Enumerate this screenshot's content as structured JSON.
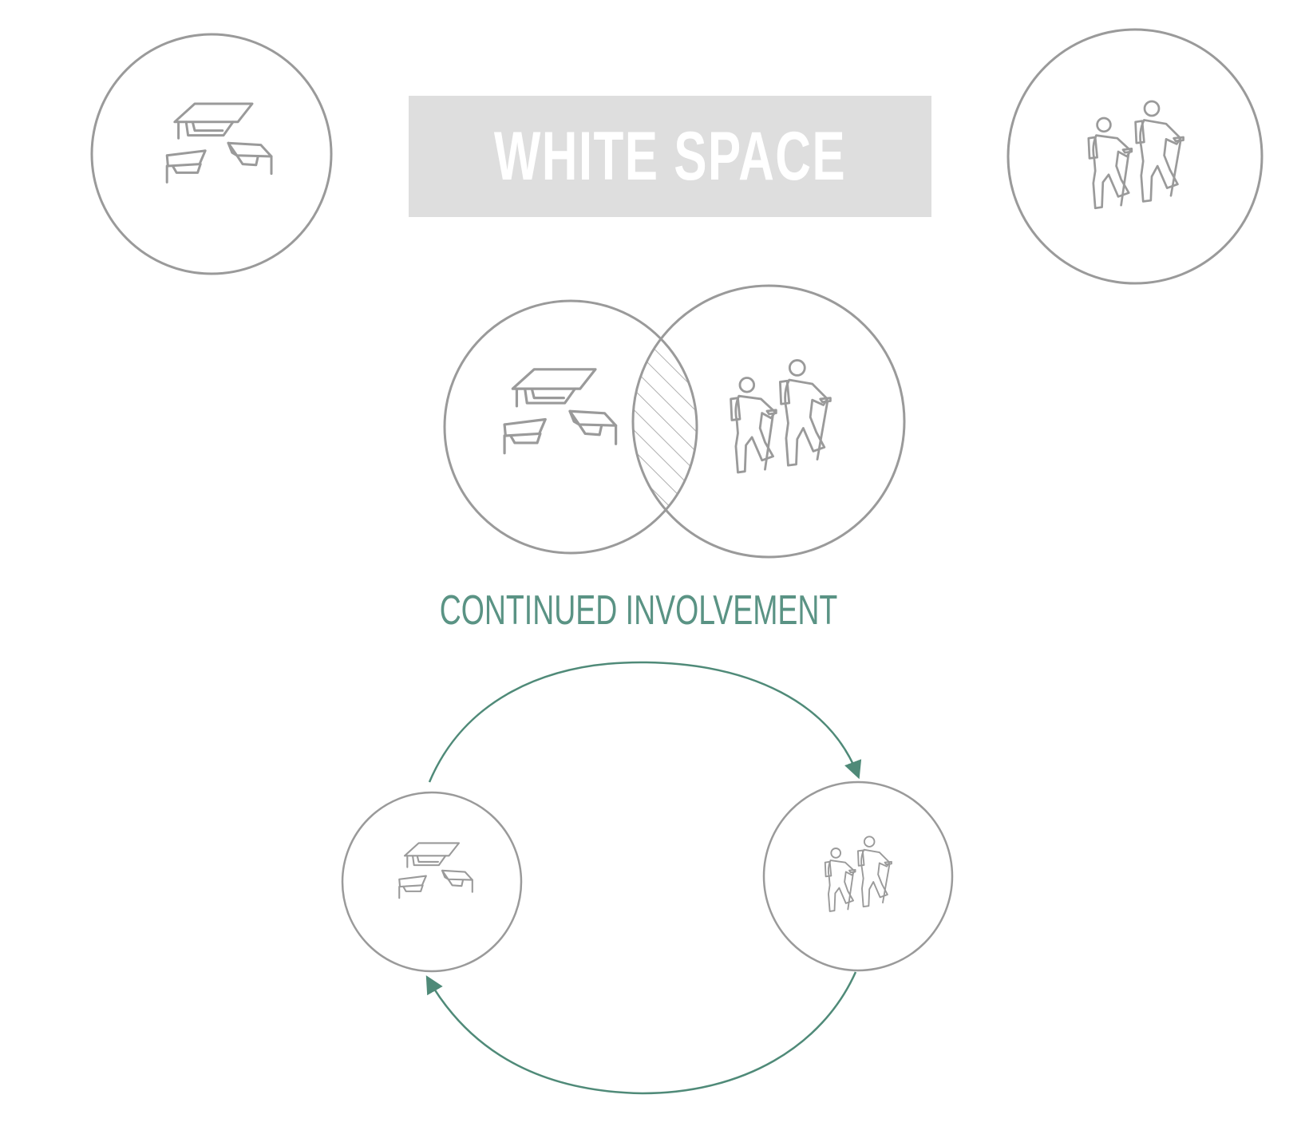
{
  "banner": {
    "label": "WHITE SPACE",
    "background_color": "#dedede",
    "text_color": "#ffffff"
  },
  "subtitle": {
    "label": "CONTINUED INVOLVEMENT",
    "color": "#5a9384"
  },
  "icons": {
    "education": "graduation-caps-icon",
    "community": "hikers-icon"
  },
  "colors": {
    "stroke": "#9a9a9a",
    "arrow": "#4f8a78"
  }
}
